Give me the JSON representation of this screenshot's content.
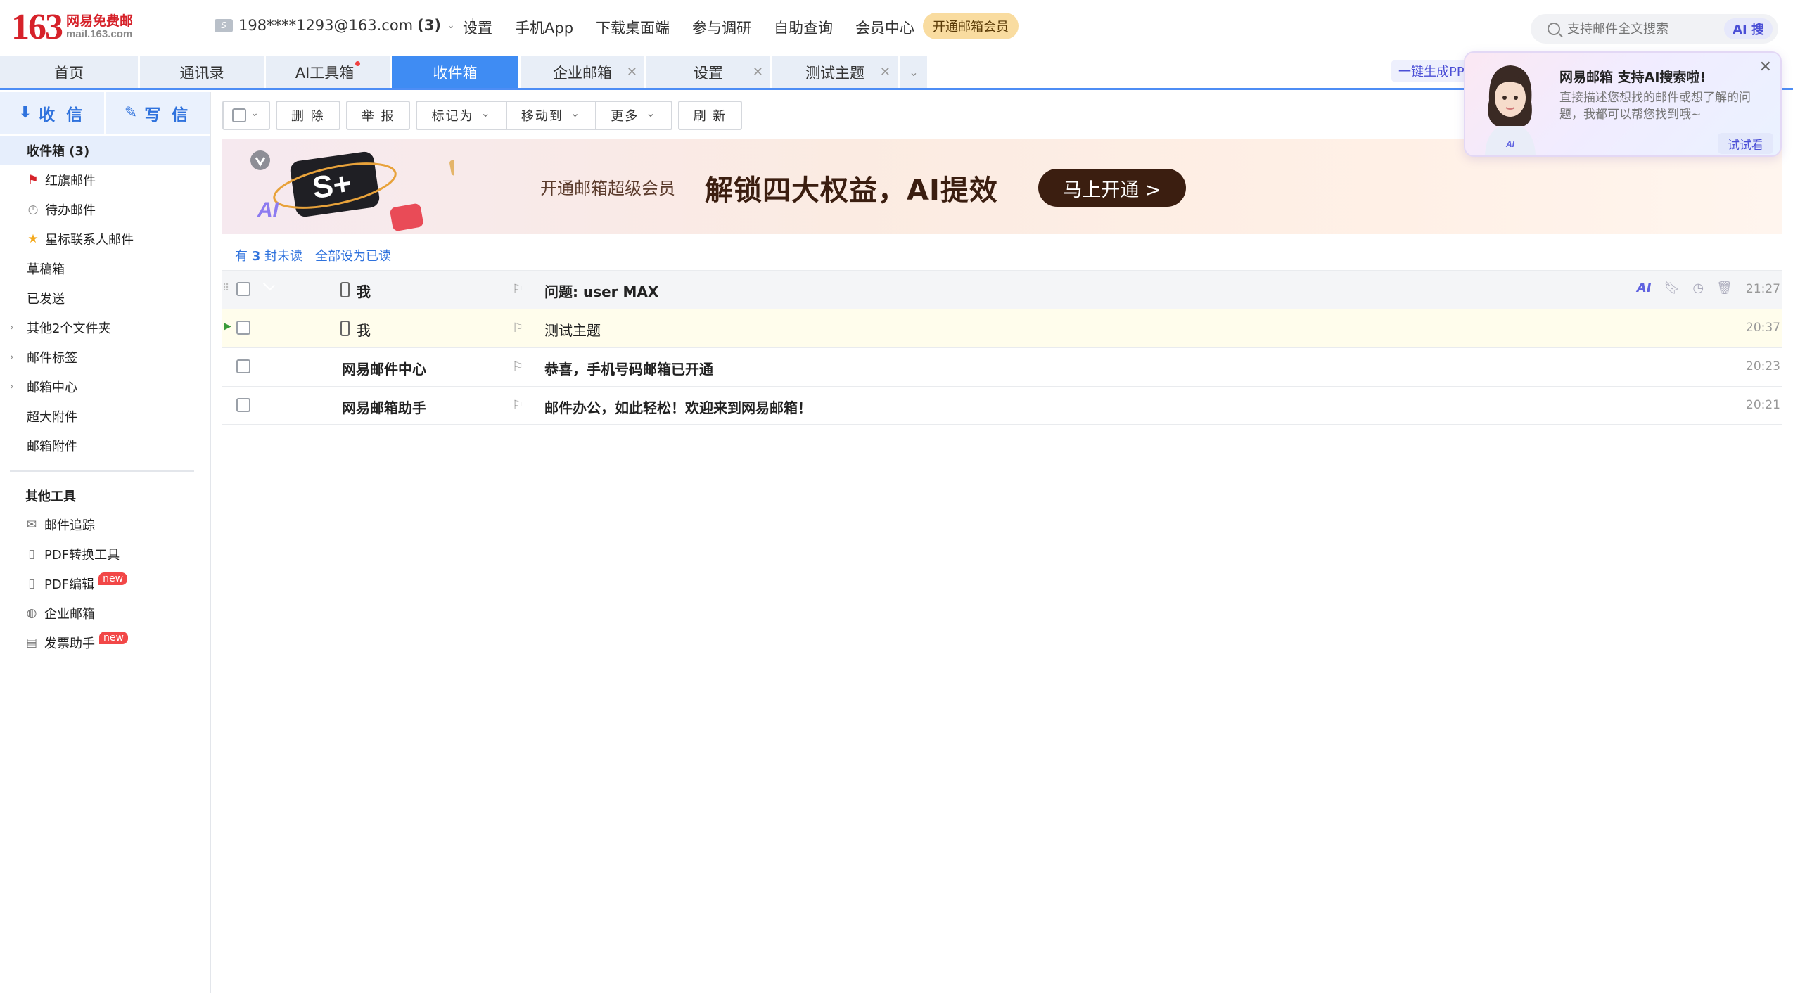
{
  "header": {
    "logo_number": "163",
    "logo_cn": "网易免费邮",
    "logo_url": "mail.163.com",
    "account_email": "198****1293@163.com",
    "account_count": "(3)",
    "nav": [
      "设置",
      "手机App",
      "下载桌面端",
      "参与调研",
      "自助查询",
      "会员中心"
    ],
    "vip_button": "开通邮箱会员",
    "search_placeholder": "支持邮件全文搜索",
    "ai_search": "AI 搜"
  },
  "tabs": [
    {
      "label": "首页",
      "active": false
    },
    {
      "label": "通讯录",
      "active": false
    },
    {
      "label": "AI工具箱",
      "active": false,
      "dot": true
    },
    {
      "label": "收件箱",
      "active": true
    },
    {
      "label": "企业邮箱",
      "active": false,
      "closable": true
    },
    {
      "label": "设置",
      "active": false,
      "closable": true
    },
    {
      "label": "测试主题",
      "active": false,
      "closable": true
    }
  ],
  "ppt_link": "一键生成PP",
  "sidebar": {
    "receive": "收 信",
    "write": "写 信",
    "folders": [
      {
        "label": "收件箱 (3)",
        "active": true
      },
      {
        "label": "红旗邮件",
        "icon": "red-flag-icon"
      },
      {
        "label": "待办邮件",
        "icon": "clock-icon"
      },
      {
        "label": "星标联系人邮件",
        "icon": "star-icon"
      },
      {
        "label": "草稿箱"
      },
      {
        "label": "已发送"
      },
      {
        "label": "其他2个文件夹",
        "expandable": true
      },
      {
        "label": "邮件标签",
        "expandable": true
      },
      {
        "label": "邮箱中心",
        "expandable": true
      },
      {
        "label": "超大附件"
      },
      {
        "label": "邮箱附件"
      }
    ],
    "tools_title": "其他工具",
    "tools": [
      {
        "label": "邮件追踪",
        "icon": "mail-track-icon"
      },
      {
        "label": "PDF转换工具",
        "icon": "pdf-icon"
      },
      {
        "label": "PDF编辑",
        "icon": "pdf-edit-icon",
        "badge": "new"
      },
      {
        "label": "企业邮箱",
        "icon": "globe-icon"
      },
      {
        "label": "发票助手",
        "icon": "invoice-icon",
        "badge": "new"
      }
    ]
  },
  "toolbar": {
    "delete": "删 除",
    "report": "举 报",
    "mark_as": "标记为",
    "move_to": "移动到",
    "more": "更多",
    "refresh": "刷 新"
  },
  "banner": {
    "text": "开通邮箱超级会员",
    "headline": "解锁四大权益，AI提效",
    "cta": "马上开通 >"
  },
  "unread": {
    "prefix": "有",
    "count": "3",
    "suffix": "封未读",
    "mark_all": "全部设为已读"
  },
  "mails": [
    {
      "sender": "我",
      "subject": "问题: user MAX",
      "time": "21:27",
      "unread": true,
      "state": "envelope",
      "phone": true
    },
    {
      "sender": "我",
      "subject": "测试主题",
      "time": "20:37",
      "unread": false,
      "state": "none",
      "phone": true
    },
    {
      "sender": "网易邮件中心",
      "subject": "恭喜，手机号码邮箱已开通",
      "time": "20:23",
      "unread": true,
      "state": "seal",
      "phone": false
    },
    {
      "sender": "网易邮箱助手",
      "subject": "邮件办公，如此轻松！欢迎来到网易邮箱！",
      "time": "20:21",
      "unread": true,
      "state": "envelope",
      "phone": false
    }
  ],
  "ai_popup": {
    "title": "网易邮箱 支持AI搜索啦!",
    "desc": "直接描述您想找的邮件或想了解的问题，我都可以帮您找到哦~",
    "try": "试试看",
    "close": "✕"
  },
  "colors": {
    "brand_red": "#d6222a",
    "accent_blue": "#3f8cf3",
    "banner_dark": "#3b1e10"
  }
}
